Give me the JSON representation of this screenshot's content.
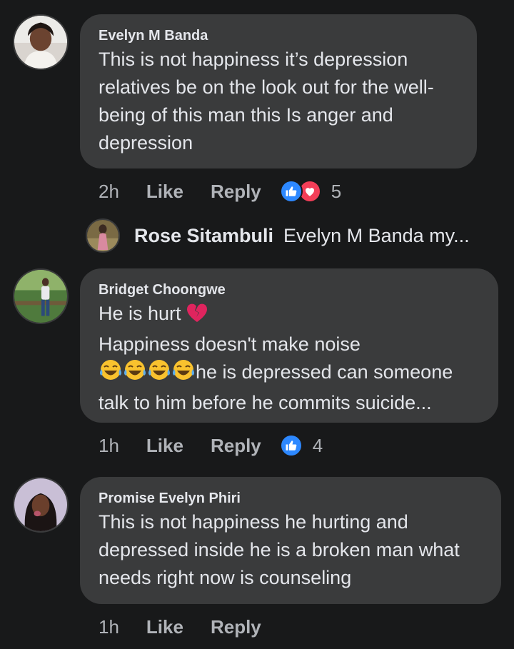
{
  "comments": [
    {
      "author": "Evelyn M Banda",
      "lines": [
        "This is not happiness it’s depression",
        "relatives be on the look out for the well-",
        "being of this man this Is anger and",
        "depression"
      ],
      "time": "2h",
      "like_label": "Like",
      "reply_label": "Reply",
      "reaction_count": "5",
      "reaction_icons": [
        "like-icon",
        "love-icon"
      ],
      "reply_preview": {
        "author": "Rose Sitambuli",
        "text": "Evelyn M Banda my..."
      }
    },
    {
      "author": "Bridget Choongwe",
      "line1": "He is hurt",
      "line2": "Happiness doesn't make noise",
      "line3": "he is depressed can someone",
      "line4": "talk to him before he commits suicide...",
      "time": "1h",
      "like_label": "Like",
      "reply_label": "Reply",
      "reaction_count": "4",
      "reaction_icons": [
        "like-icon"
      ],
      "emojis": [
        "broken-heart-icon",
        "tears-of-joy-icon"
      ]
    },
    {
      "author": "Promise Evelyn Phiri",
      "lines": [
        "This is not happiness he hurting and",
        "depressed inside he is a broken man what",
        "needs right now is counseling"
      ],
      "time": "1h",
      "like_label": "Like",
      "reply_label": "Reply"
    }
  ],
  "colors": {
    "background": "#18191a",
    "bubble": "#3a3b3c",
    "text": "#e4e6eb",
    "secondary_text": "#b0b3b8",
    "like_blue": "#2d88ff",
    "love_red": "#f33e58"
  }
}
